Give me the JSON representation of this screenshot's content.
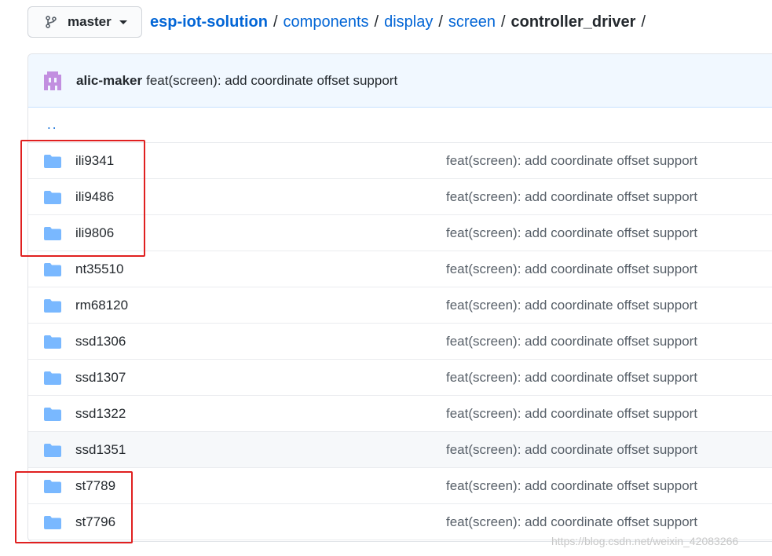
{
  "branch": {
    "label": "master",
    "icon": "git-branch-icon"
  },
  "breadcrumb": {
    "items": [
      "esp-iot-solution",
      "components",
      "display",
      "screen"
    ],
    "current": "controller_driver",
    "separator": "/"
  },
  "commit": {
    "author": "alic-maker",
    "message": "feat(screen): add coordinate offset support"
  },
  "parent_dir": "..",
  "files": [
    {
      "name": "ili9341",
      "message": "feat(screen): add coordinate offset support"
    },
    {
      "name": "ili9486",
      "message": "feat(screen): add coordinate offset support"
    },
    {
      "name": "ili9806",
      "message": "feat(screen): add coordinate offset support"
    },
    {
      "name": "nt35510",
      "message": "feat(screen): add coordinate offset support"
    },
    {
      "name": "rm68120",
      "message": "feat(screen): add coordinate offset support"
    },
    {
      "name": "ssd1306",
      "message": "feat(screen): add coordinate offset support"
    },
    {
      "name": "ssd1307",
      "message": "feat(screen): add coordinate offset support"
    },
    {
      "name": "ssd1322",
      "message": "feat(screen): add coordinate offset support"
    },
    {
      "name": "ssd1351",
      "message": "feat(screen): add coordinate offset support"
    },
    {
      "name": "st7789",
      "message": "feat(screen): add coordinate offset support"
    },
    {
      "name": "st7796",
      "message": "feat(screen): add coordinate offset support"
    }
  ],
  "watermark": "https://blog.csdn.net/weixin_42083266",
  "colors": {
    "link": "#0366d6",
    "folder": "#79b8ff",
    "commit_bar": "#f1f8ff",
    "annotation": "#e02020"
  }
}
